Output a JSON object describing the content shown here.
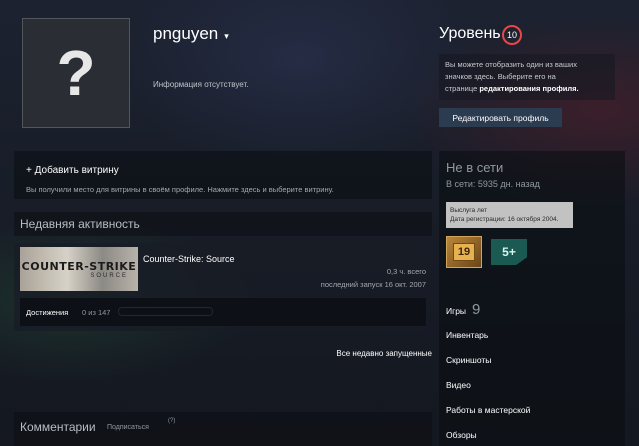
{
  "profile": {
    "avatar_glyph": "?",
    "persona_name": "pnguyen",
    "persona_caret": "▾",
    "summary": "Информация отсутствует."
  },
  "level": {
    "label": "Уровень",
    "value": "10",
    "info_line1": "Вы можете отобразить один из ваших",
    "info_line2": "значков здесь. Выберите его на",
    "info_line3_prefix": "странице ",
    "info_line3_link": "редактирования профиля.",
    "edit_button": "Редактировать профиль"
  },
  "showcase": {
    "title": "+ Добавить витрину",
    "description": "Вы получили место для витрины в своём профиле. Нажмите здесь и выберите витрину."
  },
  "recent_activity": {
    "title": "Недавняя активность",
    "games": [
      {
        "logo_main": "COUNTER-STRIKE",
        "logo_sub": "SOURCE",
        "name": "Counter-Strike: Source",
        "hours": "0,3 ч. всего",
        "last_played": "последний запуск 16 окт. 2007",
        "achievements_label": "Достижения",
        "achievements_count": "0 из 147",
        "achievements_progress": 0.0
      }
    ],
    "all_recent_link": "Все недавно запущенные"
  },
  "comments": {
    "title": "Комментарии",
    "subscribe": "Подписаться",
    "help": "(?)"
  },
  "sidebar": {
    "status": "Не в сети",
    "online_since": "В сети: 5935 дн. назад",
    "tooltip_line1": "Выслуга лет",
    "tooltip_line2": "Дата регистрации: 16 октября 2004.",
    "badges": [
      {
        "label": "19",
        "color": "#e8b14f"
      },
      {
        "label": "5+",
        "color": "#1a5a52"
      }
    ],
    "games_label": "Игры",
    "games_count": "9",
    "nav": [
      "Инвентарь",
      "Скриншоты",
      "Видео",
      "Работы в мастерской",
      "Обзоры"
    ]
  }
}
